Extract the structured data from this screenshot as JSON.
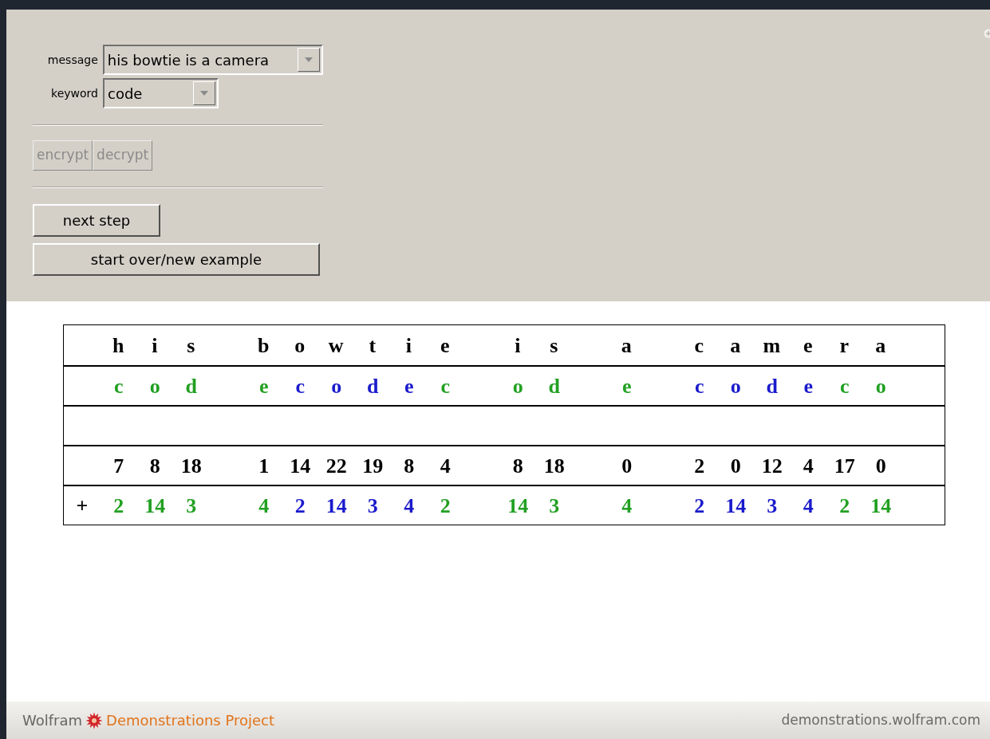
{
  "controls": {
    "message": {
      "label": "message",
      "value": "his bowtie is a camera"
    },
    "keyword": {
      "label": "keyword",
      "value": "code"
    },
    "mode_buttons": [
      {
        "label": "encrypt"
      },
      {
        "label": "decrypt"
      }
    ],
    "buttons": [
      {
        "label": "next step",
        "kind": "short"
      },
      {
        "label": "start over/new example",
        "kind": "wide"
      }
    ]
  },
  "table": {
    "plus_sign": "+",
    "columns": [
      {
        "kind": "char",
        "letter": "h",
        "key": "c",
        "number": "7",
        "shift": "2",
        "color": "#22a022"
      },
      {
        "kind": "char",
        "letter": "i",
        "key": "o",
        "number": "8",
        "shift": "14",
        "color": "#22a022"
      },
      {
        "kind": "char",
        "letter": "s",
        "key": "d",
        "number": "18",
        "shift": "3",
        "color": "#22a022"
      },
      {
        "kind": "gap"
      },
      {
        "kind": "char",
        "letter": "b",
        "key": "e",
        "number": "1",
        "shift": "4",
        "color": "#22a022"
      },
      {
        "kind": "char",
        "letter": "o",
        "key": "c",
        "number": "14",
        "shift": "2",
        "color": "#1a1acc"
      },
      {
        "kind": "char",
        "letter": "w",
        "key": "o",
        "number": "22",
        "shift": "14",
        "color": "#1a1acc"
      },
      {
        "kind": "char",
        "letter": "t",
        "key": "d",
        "number": "19",
        "shift": "3",
        "color": "#1a1acc"
      },
      {
        "kind": "char",
        "letter": "i",
        "key": "e",
        "number": "8",
        "shift": "4",
        "color": "#1a1acc"
      },
      {
        "kind": "char",
        "letter": "e",
        "key": "c",
        "number": "4",
        "shift": "2",
        "color": "#22a022"
      },
      {
        "kind": "gap"
      },
      {
        "kind": "char",
        "letter": "i",
        "key": "o",
        "number": "8",
        "shift": "14",
        "color": "#22a022"
      },
      {
        "kind": "char",
        "letter": "s",
        "key": "d",
        "number": "18",
        "shift": "3",
        "color": "#22a022"
      },
      {
        "kind": "gap"
      },
      {
        "kind": "char",
        "letter": "a",
        "key": "e",
        "number": "0",
        "shift": "4",
        "color": "#22a022"
      },
      {
        "kind": "gap"
      },
      {
        "kind": "char",
        "letter": "c",
        "key": "c",
        "number": "2",
        "shift": "2",
        "color": "#1a1acc"
      },
      {
        "kind": "char",
        "letter": "a",
        "key": "o",
        "number": "0",
        "shift": "14",
        "color": "#1a1acc"
      },
      {
        "kind": "char",
        "letter": "m",
        "key": "d",
        "number": "12",
        "shift": "3",
        "color": "#1a1acc"
      },
      {
        "kind": "char",
        "letter": "e",
        "key": "e",
        "number": "4",
        "shift": "4",
        "color": "#1a1acc"
      },
      {
        "kind": "char",
        "letter": "r",
        "key": "c",
        "number": "17",
        "shift": "2",
        "color": "#22a022"
      },
      {
        "kind": "char",
        "letter": "a",
        "key": "o",
        "number": "0",
        "shift": "14",
        "color": "#22a022"
      }
    ]
  },
  "footer": {
    "brand_left": "Wolfram",
    "brand_right": "Demonstrations Project",
    "site": "demonstrations.wolfram.com"
  }
}
